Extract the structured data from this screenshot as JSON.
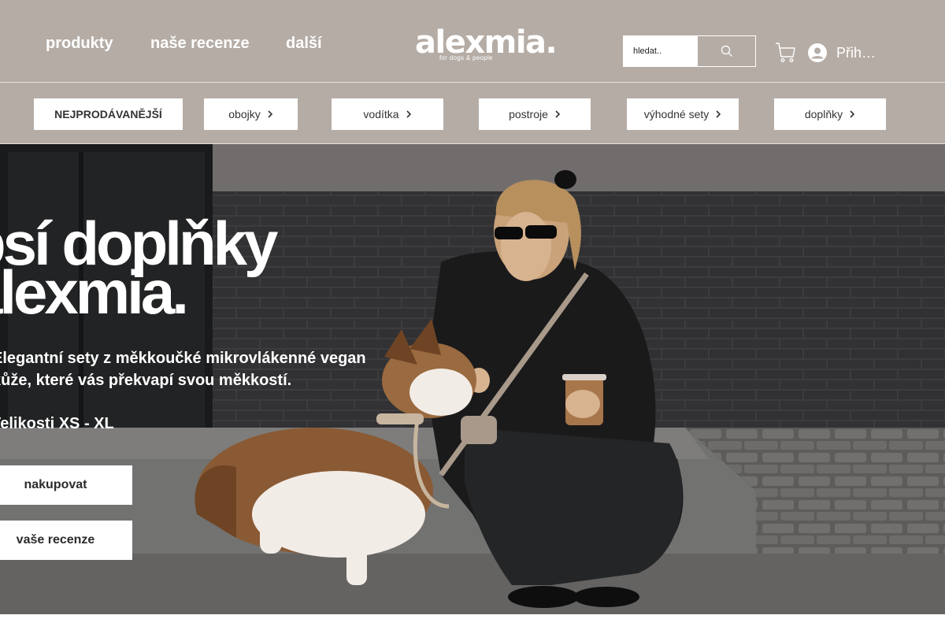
{
  "header": {
    "nav": [
      {
        "label": "produkty"
      },
      {
        "label": "naše recenze"
      },
      {
        "label": "další"
      }
    ],
    "logo": {
      "name": "alexmia.",
      "tagline": "for dogs & people"
    },
    "search": {
      "placeholder": "hledat..",
      "icon": "search-icon"
    },
    "cart": {
      "icon": "cart-icon"
    },
    "login": {
      "label": "Přih…",
      "icon": "user-avatar-icon"
    }
  },
  "categories": [
    {
      "label": "NEJPRODÁVANĚJŠÍ"
    },
    {
      "label": "obojky",
      "icon": "chevron-right-icon"
    },
    {
      "label": "vodítka",
      "icon": "chevron-right-icon"
    },
    {
      "label": "postroje",
      "icon": "chevron-right-icon"
    },
    {
      "label": "výhodné sety",
      "icon": "chevron-right-icon"
    },
    {
      "label": "doplňky",
      "icon": "chevron-right-icon"
    }
  ],
  "hero": {
    "title_line1": "psí doplňky",
    "title_line2": "alexmia.",
    "desc_line1": "Elegantní sety z měkkoučké mikrovlákenné vegan",
    "desc_line2": "kůže, které vás překvapí svou měkkostí.",
    "sizes": "Velikosti XS - XL",
    "buttons": [
      {
        "label": "nakupovat"
      },
      {
        "label": "vaše recenze"
      }
    ]
  },
  "colors": {
    "header_bg": "#b5aca5",
    "text_white": "#ffffff",
    "button_bg": "#ffffff",
    "button_text": "#2b2b2b"
  }
}
